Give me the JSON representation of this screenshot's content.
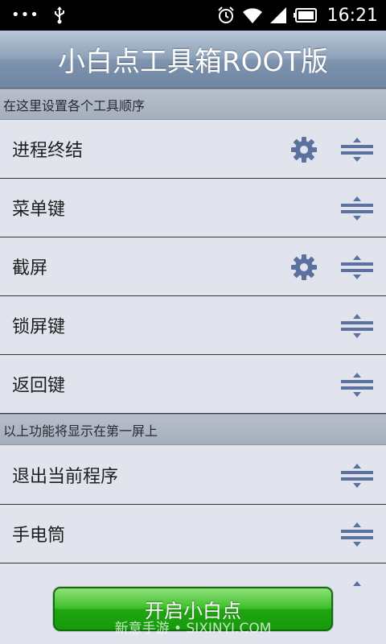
{
  "status_bar": {
    "time": "16:21",
    "icons": [
      "more-dots-icon",
      "usb-icon",
      "alarm-icon",
      "wifi-icon",
      "signal-icon",
      "battery-icon"
    ]
  },
  "header": {
    "title": "小白点工具箱ROOT版"
  },
  "sections": [
    {
      "header": "在这里设置各个工具顺序",
      "items": [
        {
          "label": "进程终结",
          "has_settings": true
        },
        {
          "label": "菜单键",
          "has_settings": false
        },
        {
          "label": "截屏",
          "has_settings": true
        },
        {
          "label": "锁屏键",
          "has_settings": false
        },
        {
          "label": "返回键",
          "has_settings": false
        }
      ]
    },
    {
      "header": "以上功能将显示在第一屏上",
      "items": [
        {
          "label": "退出当前程序",
          "has_settings": false
        },
        {
          "label": "手电筒",
          "has_settings": false
        }
      ]
    }
  ],
  "start_button": {
    "label": "开启小白点"
  },
  "watermark": "新意手游 • SIXINYI.COM",
  "colors": {
    "title_bar": "#8ea2ba",
    "section_header": "#aeb6c2",
    "row_background": "#e1e4ec",
    "icon_blue": "#5b72a0",
    "start_button_green": "#2bb01a"
  }
}
